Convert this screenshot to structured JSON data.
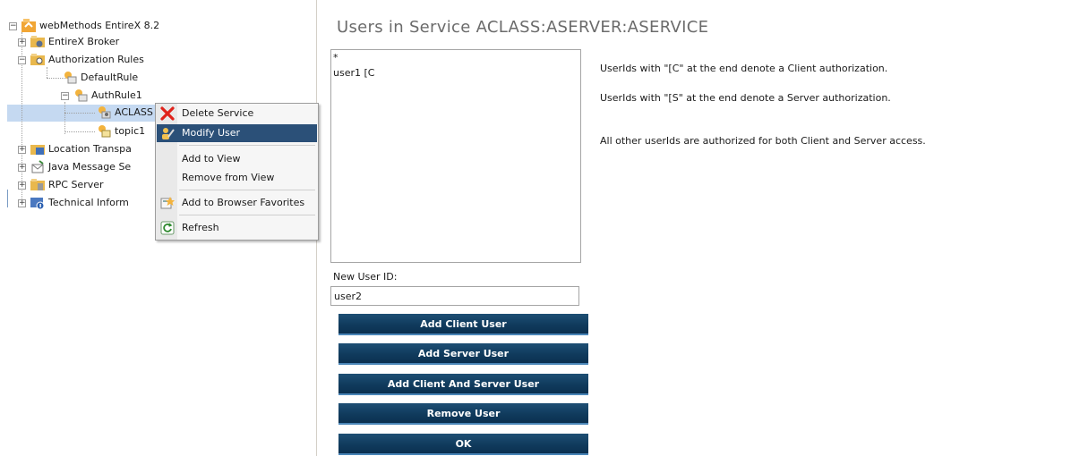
{
  "tree": {
    "root": "webMethods EntireX 8.2",
    "items": [
      {
        "label": "EntireX Broker",
        "expander": "+"
      },
      {
        "label": "Authorization Rules",
        "expander": "−"
      },
      {
        "label": "DefaultRule"
      },
      {
        "label": "AuthRule1",
        "expander": "−"
      },
      {
        "label": "ACLASS"
      },
      {
        "label": "topic1"
      },
      {
        "label": "Location Transpa",
        "expander": "+"
      },
      {
        "label": "Java Message Se",
        "expander": "+"
      },
      {
        "label": "RPC Server",
        "expander": "+"
      },
      {
        "label": "Technical Inform",
        "expander": "+"
      }
    ],
    "root_expander": "−",
    "selected_bg": "#c5d9f1"
  },
  "context_menu": {
    "items": [
      {
        "label": "Delete Service",
        "icon": "red-x-icon"
      },
      {
        "label": "Modify User",
        "icon": "users-icon",
        "active": true
      },
      {
        "label": "Add to View"
      },
      {
        "label": "Remove from View"
      },
      {
        "label": "Add to Browser Favorites",
        "icon": "favorites-icon"
      },
      {
        "label": "Refresh",
        "icon": "refresh-icon"
      }
    ],
    "active_color": "#2b5078"
  },
  "main": {
    "title": "Users in Service ACLASS:ASERVER:ASERVICE",
    "users": [
      "*",
      "user1 [C"
    ],
    "new_user_label": "New User ID:",
    "new_user_value": "user2",
    "buttons": {
      "add_client": "Add Client User",
      "add_server": "Add Server User",
      "add_both": "Add Client And Server User",
      "remove": "Remove User",
      "ok": "OK"
    },
    "hints": {
      "client": "UserIds with \"[C\" at the end denote a Client authorization.",
      "server": "UserIds with \"[S\" at the end denote a Server authorization.",
      "both": "All other userIds are authorized for both Client and Server access."
    },
    "button_color": "#123f62"
  }
}
